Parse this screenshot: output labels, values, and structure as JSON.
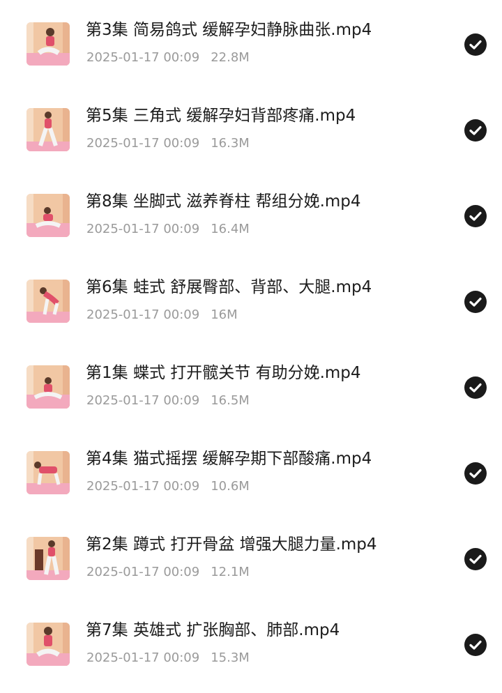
{
  "files": [
    {
      "name": "第3集 简易鸽式 缓解孕妇静脉曲张.mp4",
      "date": "2025-01-17 00:09",
      "size": "22.8M",
      "thumb": "thumbnail-pose-seated",
      "status": "selected"
    },
    {
      "name": "第5集 三角式 缓解孕妇背部疼痛.mp4",
      "date": "2025-01-17 00:09",
      "size": "16.3M",
      "thumb": "thumbnail-pose-standing",
      "status": "selected"
    },
    {
      "name": "第8集 坐脚式 滋养脊柱 帮组分娩.mp4",
      "date": "2025-01-17 00:09",
      "size": "16.4M",
      "thumb": "thumbnail-pose-kneeling",
      "status": "selected"
    },
    {
      "name": "第6集 蛙式 舒展臀部、背部、大腿.mp4",
      "date": "2025-01-17 00:09",
      "size": "16M",
      "thumb": "thumbnail-pose-bent",
      "status": "selected"
    },
    {
      "name": "第1集 蝶式 打开髋关节 有助分娩.mp4",
      "date": "2025-01-17 00:09",
      "size": "16.5M",
      "thumb": "thumbnail-pose-kneeling",
      "status": "selected"
    },
    {
      "name": "第4集 猫式摇摆 缓解孕期下部酸痛.mp4",
      "date": "2025-01-17 00:09",
      "size": "10.6M",
      "thumb": "thumbnail-pose-bent",
      "status": "selected"
    },
    {
      "name": "第2集 蹲式 打开骨盆 增强大腿力量.mp4",
      "date": "2025-01-17 00:09",
      "size": "12.1M",
      "thumb": "thumbnail-pose-standing",
      "status": "selected"
    },
    {
      "name": "第7集 英雄式 扩张胸部、肺部.mp4",
      "date": "2025-01-17 00:09",
      "size": "15.3M",
      "thumb": "thumbnail-pose-seated",
      "status": "selected"
    }
  ],
  "colors": {
    "name_text": "#1c1c1c",
    "meta_text": "#9a9a9a",
    "check_fill": "#1a1a1a",
    "thumb_bg": "#f1c7a4",
    "thumb_floor": "#f3a9bd"
  }
}
